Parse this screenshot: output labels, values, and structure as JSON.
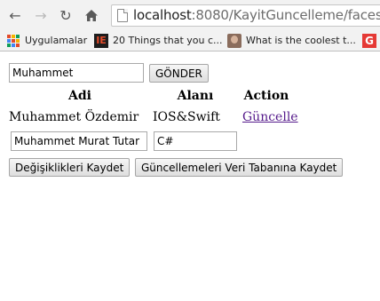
{
  "browser": {
    "url_host": "localhost",
    "url_rest": ":8080/KayitGuncelleme/faces/in",
    "bookmarks": [
      {
        "label": "Uygulamalar",
        "icon": "apps-grid-icon"
      },
      {
        "label": "20 Things that you c...",
        "icon": "ie-favicon"
      },
      {
        "label": "What is the coolest t...",
        "icon": "profile-favicon"
      },
      {
        "label": "",
        "icon": "g-favicon"
      }
    ]
  },
  "form": {
    "search_value": "Muhammet",
    "submit_label": "GÖNDER"
  },
  "table": {
    "headers": [
      "Adi",
      "Alanı",
      "Action"
    ],
    "row": {
      "name": "Muhammet Özdemir",
      "field": "IOS&Swift",
      "action": "Güncelle"
    }
  },
  "edit": {
    "name_value": "Muhammet Murat Tutar",
    "field_value": "C#"
  },
  "buttons": {
    "save_changes": "Değişiklikleri Kaydet",
    "save_to_db": "Güncellemeleri Veri Tabanına Kaydet"
  },
  "colors": {
    "chrome_bg": "#f2f2f2",
    "link_visited": "#551a8b",
    "favicon_red": "#e53935"
  }
}
